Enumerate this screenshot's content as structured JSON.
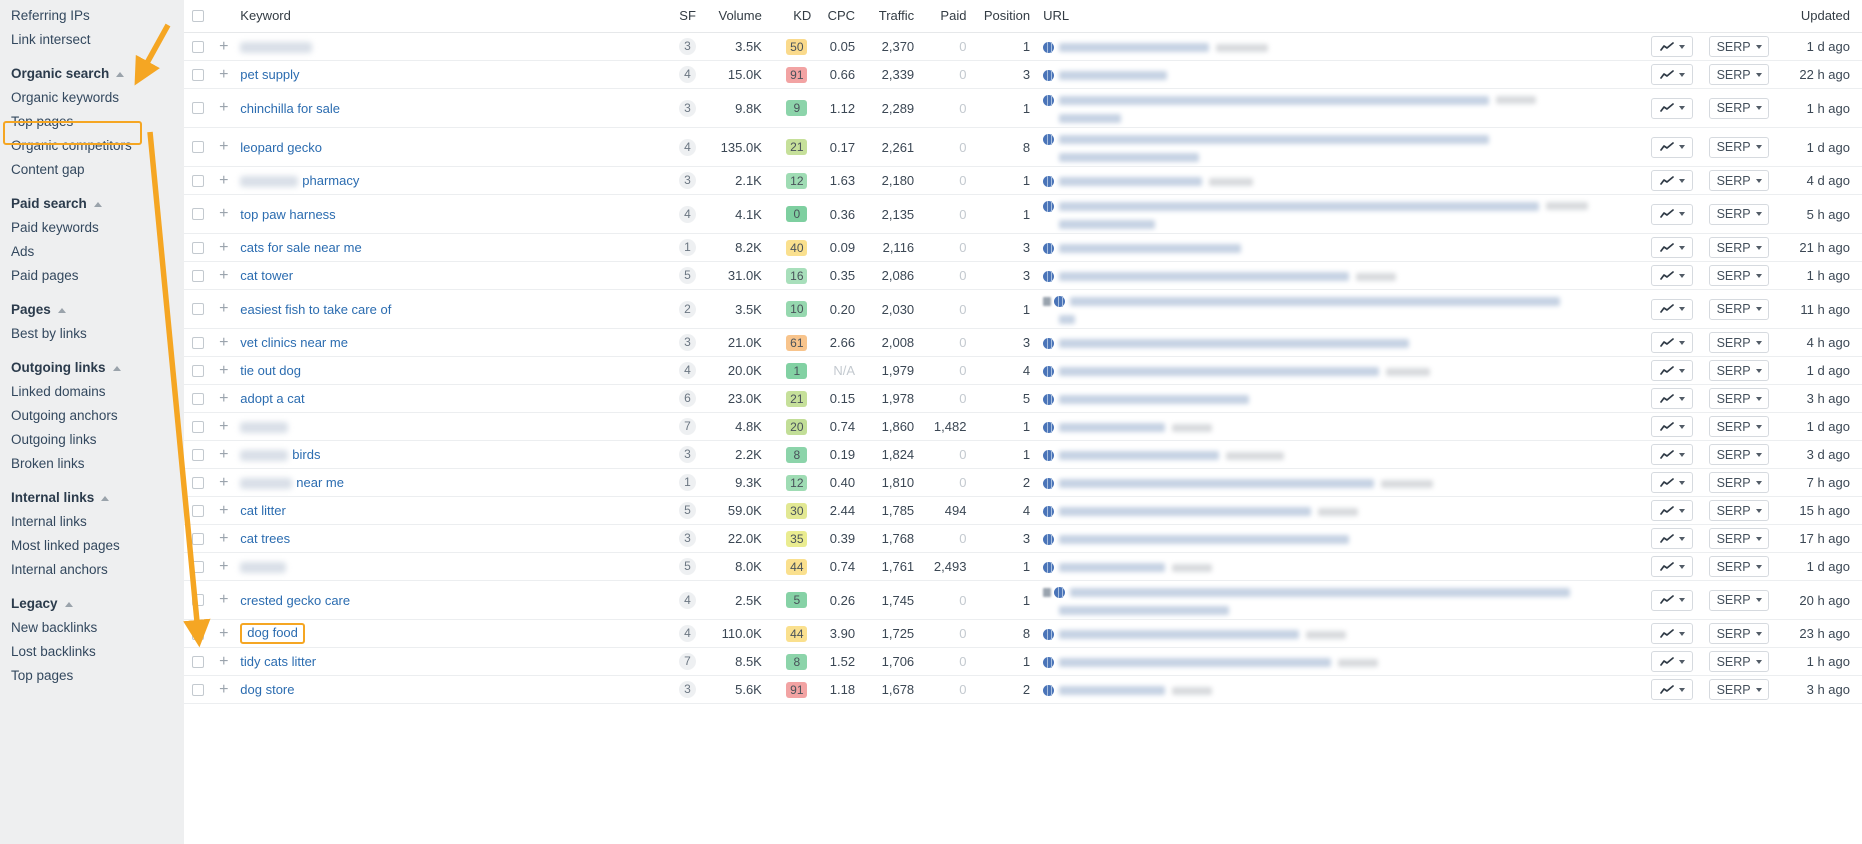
{
  "sidebar": {
    "items": [
      {
        "label": "Referring IPs",
        "type": "link"
      },
      {
        "label": "Link intersect",
        "type": "link"
      },
      {
        "label": "Organic search",
        "type": "group"
      },
      {
        "label": "Organic keywords",
        "type": "link",
        "selected": true
      },
      {
        "label": "Top pages",
        "type": "link"
      },
      {
        "label": "Organic competitors",
        "type": "link"
      },
      {
        "label": "Content gap",
        "type": "link"
      },
      {
        "label": "Paid search",
        "type": "group"
      },
      {
        "label": "Paid keywords",
        "type": "link"
      },
      {
        "label": "Ads",
        "type": "link"
      },
      {
        "label": "Paid pages",
        "type": "link"
      },
      {
        "label": "Pages",
        "type": "group"
      },
      {
        "label": "Best by links",
        "type": "link"
      },
      {
        "label": "Outgoing links",
        "type": "group"
      },
      {
        "label": "Linked domains",
        "type": "link"
      },
      {
        "label": "Outgoing anchors",
        "type": "link"
      },
      {
        "label": "Outgoing links",
        "type": "link"
      },
      {
        "label": "Broken links",
        "type": "link"
      },
      {
        "label": "Internal links",
        "type": "group"
      },
      {
        "label": "Internal links",
        "type": "link"
      },
      {
        "label": "Most linked pages",
        "type": "link"
      },
      {
        "label": "Internal anchors",
        "type": "link"
      },
      {
        "label": "Legacy",
        "type": "group"
      },
      {
        "label": "New backlinks",
        "type": "link"
      },
      {
        "label": "Lost backlinks",
        "type": "link"
      },
      {
        "label": "Top pages",
        "type": "link"
      }
    ]
  },
  "table": {
    "columns": {
      "keyword": "Keyword",
      "sf": "SF",
      "volume": "Volume",
      "kd": "KD",
      "cpc": "CPC",
      "traffic": "Traffic",
      "paid": "Paid",
      "position": "Position",
      "url": "URL",
      "updated": "Updated"
    },
    "row_buttons": {
      "chart_label": "",
      "serp_label": "SERP"
    },
    "rows": [
      {
        "keyword": "",
        "redacted": true,
        "redacted_width": 72,
        "sf": "3",
        "volume": "3.5K",
        "kd": "50",
        "kd_color": "#fada8c",
        "cpc": "0.05",
        "traffic": "2,370",
        "paid": "0",
        "position": "1",
        "updated": "1 d ago",
        "url_w": 150,
        "url_w2": 52,
        "url_lines": 1,
        "height": "normal"
      },
      {
        "keyword": "pet supply",
        "redacted": false,
        "sf": "4",
        "volume": "15.0K",
        "kd": "91",
        "kd_color": "#f2a3a3",
        "cpc": "0.66",
        "traffic": "2,339",
        "paid": "0",
        "position": "3",
        "updated": "22 h ago",
        "url_w": 108,
        "url_w2": 0,
        "url_lines": 1,
        "height": "normal"
      },
      {
        "keyword": "chinchilla for sale",
        "redacted": false,
        "sf": "3",
        "volume": "9.8K",
        "kd": "9",
        "kd_color": "#8cd4aa",
        "cpc": "1.12",
        "traffic": "2,289",
        "paid": "0",
        "position": "1",
        "updated": "1 h ago",
        "url_w": 430,
        "url_w2": 40,
        "url_lines": 2,
        "url_w_line2": 62,
        "height": "tall"
      },
      {
        "keyword": "leopard gecko",
        "redacted": false,
        "sf": "4",
        "volume": "135.0K",
        "kd": "21",
        "kd_color": "#c6e09a",
        "cpc": "0.17",
        "traffic": "2,261",
        "paid": "0",
        "position": "8",
        "updated": "1 d ago",
        "url_w": 430,
        "url_w2": 0,
        "url_lines": 2,
        "url_w_line2": 140,
        "height": "tall"
      },
      {
        "keyword": "pharmacy",
        "redacted": true,
        "redacted_prefix": 58,
        "sf": "3",
        "volume": "2.1K",
        "kd": "12",
        "kd_color": "#9fdcb4",
        "cpc": "1.63",
        "traffic": "2,180",
        "paid": "0",
        "position": "1",
        "updated": "4 d ago",
        "url_w": 143,
        "url_w2": 44,
        "url_lines": 1,
        "height": "normal"
      },
      {
        "keyword": "top paw harness",
        "redacted": false,
        "sf": "4",
        "volume": "4.1K",
        "kd": "0",
        "kd_color": "#7ecfa0",
        "cpc": "0.36",
        "traffic": "2,135",
        "paid": "0",
        "position": "1",
        "updated": "5 h ago",
        "url_w": 480,
        "url_w2": 42,
        "url_lines": 2,
        "url_w_line2": 96,
        "height": "tall"
      },
      {
        "keyword": "cats for sale near me",
        "redacted": false,
        "sf": "1",
        "volume": "8.2K",
        "kd": "40",
        "kd_color": "#fae08e",
        "cpc": "0.09",
        "traffic": "2,116",
        "paid": "0",
        "position": "3",
        "updated": "21 h ago",
        "url_w": 182,
        "url_w2": 0,
        "url_lines": 1,
        "height": "normal"
      },
      {
        "keyword": "cat tower",
        "redacted": false,
        "sf": "5",
        "volume": "31.0K",
        "kd": "16",
        "kd_color": "#a8dfbb",
        "cpc": "0.35",
        "traffic": "2,086",
        "paid": "0",
        "position": "3",
        "updated": "1 h ago",
        "url_w": 290,
        "url_w2": 40,
        "url_lines": 1,
        "height": "normal"
      },
      {
        "keyword": "easiest fish to take care of",
        "redacted": false,
        "sf": "2",
        "volume": "3.5K",
        "kd": "10",
        "kd_color": "#96d8af",
        "cpc": "0.20",
        "traffic": "2,030",
        "paid": "0",
        "position": "1",
        "updated": "11 h ago",
        "url_w": 490,
        "url_w2": 0,
        "url_lines": 2,
        "url_w_line2": 16,
        "height": "tall",
        "sf_icon": true
      },
      {
        "keyword": "vet clinics near me",
        "redacted": false,
        "sf": "3",
        "volume": "21.0K",
        "kd": "61",
        "kd_color": "#f8c48c",
        "cpc": "2.66",
        "traffic": "2,008",
        "paid": "0",
        "position": "3",
        "updated": "4 h ago",
        "url_w": 350,
        "url_w2": 0,
        "url_lines": 1,
        "height": "normal"
      },
      {
        "keyword": "tie out dog",
        "redacted": false,
        "sf": "4",
        "volume": "20.0K",
        "kd": "1",
        "kd_color": "#82d1a3",
        "cpc": "N/A",
        "traffic": "1,979",
        "paid": "0",
        "position": "4",
        "updated": "1 d ago",
        "url_w": 320,
        "url_w2": 44,
        "url_lines": 1,
        "height": "normal"
      },
      {
        "keyword": "adopt a cat",
        "redacted": false,
        "sf": "6",
        "volume": "23.0K",
        "kd": "21",
        "kd_color": "#c6e09a",
        "cpc": "0.15",
        "traffic": "1,978",
        "paid": "0",
        "position": "5",
        "updated": "3 h ago",
        "url_w": 190,
        "url_w2": 0,
        "url_lines": 1,
        "height": "normal"
      },
      {
        "keyword": "",
        "redacted": true,
        "redacted_width": 48,
        "sf": "7",
        "volume": "4.8K",
        "kd": "20",
        "kd_color": "#c2de97",
        "cpc": "0.74",
        "traffic": "1,860",
        "paid": "1,482",
        "position": "1",
        "updated": "1 d ago",
        "url_w": 106,
        "url_w2": 40,
        "url_lines": 1,
        "height": "normal"
      },
      {
        "keyword": "birds",
        "redacted": true,
        "redacted_prefix": 48,
        "sf": "3",
        "volume": "2.2K",
        "kd": "8",
        "kd_color": "#8cd4aa",
        "cpc": "0.19",
        "traffic": "1,824",
        "paid": "0",
        "position": "1",
        "updated": "3 d ago",
        "url_w": 160,
        "url_w2": 58,
        "url_lines": 1,
        "height": "normal"
      },
      {
        "keyword": "near me",
        "redacted": true,
        "redacted_prefix": 52,
        "sf": "1",
        "volume": "9.3K",
        "kd": "12",
        "kd_color": "#9fdcb4",
        "cpc": "0.40",
        "traffic": "1,810",
        "paid": "0",
        "position": "2",
        "updated": "7 h ago",
        "url_w": 315,
        "url_w2": 52,
        "url_lines": 1,
        "height": "normal"
      },
      {
        "keyword": "cat litter",
        "redacted": false,
        "sf": "5",
        "volume": "59.0K",
        "kd": "30",
        "kd_color": "#e2e893",
        "cpc": "2.44",
        "traffic": "1,785",
        "paid": "494",
        "position": "4",
        "updated": "15 h ago",
        "url_w": 252,
        "url_w2": 40,
        "url_lines": 1,
        "height": "normal"
      },
      {
        "keyword": "cat trees",
        "redacted": false,
        "sf": "3",
        "volume": "22.0K",
        "kd": "35",
        "kd_color": "#eaec90",
        "cpc": "0.39",
        "traffic": "1,768",
        "paid": "0",
        "position": "3",
        "updated": "17 h ago",
        "url_w": 290,
        "url_w2": 0,
        "url_lines": 1,
        "height": "normal"
      },
      {
        "keyword": "",
        "redacted": true,
        "redacted_width": 46,
        "sf": "5",
        "volume": "8.0K",
        "kd": "44",
        "kd_color": "#fae08e",
        "cpc": "0.74",
        "traffic": "1,761",
        "paid": "2,493",
        "position": "1",
        "updated": "1 d ago",
        "url_w": 106,
        "url_w2": 40,
        "url_lines": 1,
        "height": "normal"
      },
      {
        "keyword": "crested gecko care",
        "redacted": false,
        "sf": "4",
        "volume": "2.5K",
        "kd": "5",
        "kd_color": "#86d2a6",
        "cpc": "0.26",
        "traffic": "1,745",
        "paid": "0",
        "position": "1",
        "updated": "20 h ago",
        "url_w": 500,
        "url_w2": 0,
        "url_lines": 2,
        "url_w_line2": 170,
        "height": "tall",
        "sf_icon": true
      },
      {
        "keyword": "dog food",
        "redacted": false,
        "highlight": true,
        "sf": "4",
        "volume": "110.0K",
        "kd": "44",
        "kd_color": "#fae08e",
        "cpc": "3.90",
        "traffic": "1,725",
        "paid": "0",
        "position": "8",
        "updated": "23 h ago",
        "url_w": 240,
        "url_w2": 40,
        "url_lines": 1,
        "height": "normal"
      },
      {
        "keyword": "tidy cats litter",
        "redacted": false,
        "sf": "7",
        "volume": "8.5K",
        "kd": "8",
        "kd_color": "#8cd4aa",
        "cpc": "1.52",
        "traffic": "1,706",
        "paid": "0",
        "position": "1",
        "updated": "1 h ago",
        "url_w": 272,
        "url_w2": 40,
        "url_lines": 1,
        "height": "normal"
      },
      {
        "keyword": "dog store",
        "redacted": false,
        "sf": "3",
        "volume": "5.6K",
        "kd": "91",
        "kd_color": "#f2a3a3",
        "cpc": "1.18",
        "traffic": "1,678",
        "paid": "0",
        "position": "2",
        "updated": "3 h ago",
        "url_w": 106,
        "url_w2": 40,
        "url_lines": 1,
        "height": "normal"
      }
    ]
  },
  "annotations": {
    "highlight_color": "#f5a623",
    "arrow_color": "#f5a623",
    "arrow_top_target": "Organic keywords",
    "arrow_bottom_target": "dog food"
  }
}
